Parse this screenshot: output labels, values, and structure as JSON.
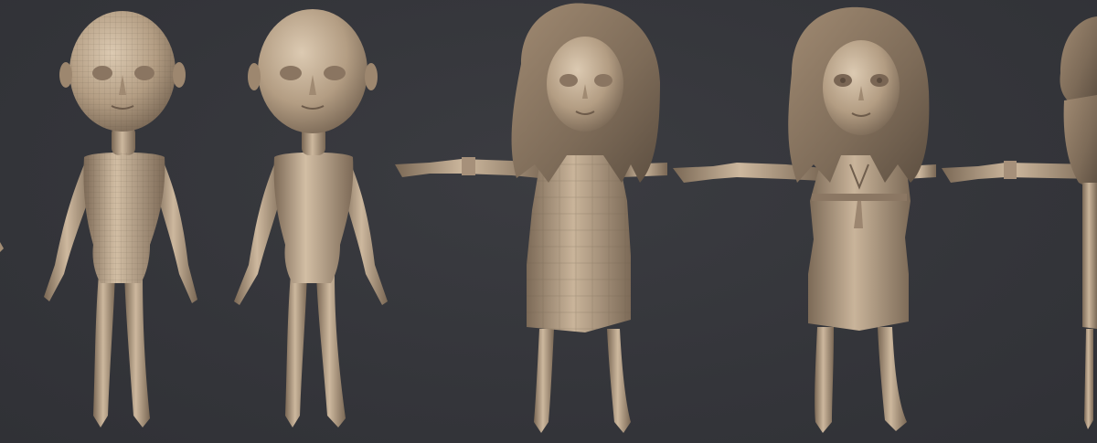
{
  "scene": {
    "background_color": "#34353a",
    "material_color": "#b09a80",
    "material_shadow": "#6e5d4c",
    "material_highlight": "#d8c6ae"
  },
  "figures": [
    {
      "id": "base-mesh-lowpoly",
      "kind": "bald body, low-poly wireframe shading, A-pose"
    },
    {
      "id": "base-mesh-smooth",
      "kind": "bald body, smoothed, A-pose"
    },
    {
      "id": "girl-dress-lowpoly",
      "kind": "long hair, faceted dress, T-pose"
    },
    {
      "id": "girl-dress-detailed",
      "kind": "long hair, belted dress, T-pose"
    },
    {
      "id": "girl-cropped",
      "kind": "partial figure at right edge, T-pose"
    }
  ]
}
